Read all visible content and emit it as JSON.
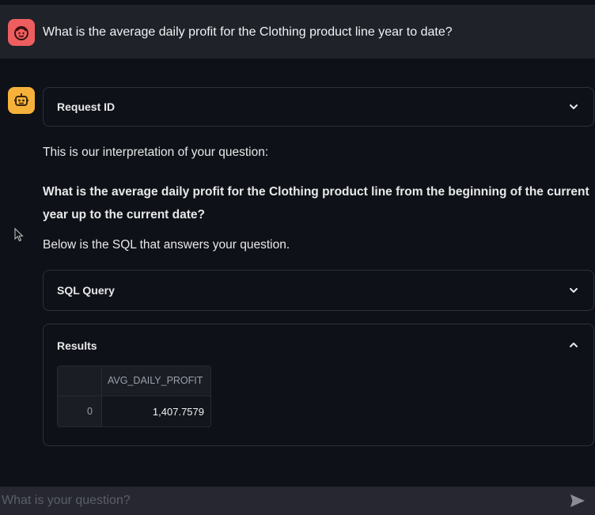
{
  "user_message": {
    "text": "What is the average daily profit for the Clothing product line year to date?",
    "avatar_icon": "smiling-face-icon",
    "avatar_color": "#ee5e5e"
  },
  "assistant": {
    "avatar_icon": "robot-icon",
    "avatar_color": "#f5b13a",
    "request_expander": {
      "label": "Request ID",
      "state": "collapsed"
    },
    "intro_text": "This is our interpretation of your question:",
    "interpretation": "What is the average daily profit for the Clothing product line from the beginning of the current year up to the current date?",
    "sql_intro": "Below is the SQL that answers your question.",
    "sql_expander": {
      "label": "SQL Query",
      "state": "collapsed"
    },
    "results_expander": {
      "label": "Results",
      "state": "expanded",
      "table": {
        "columns": [
          "",
          "AVG_DAILY_PROFIT"
        ],
        "rows": [
          {
            "index": "0",
            "avg_daily_profit": "1,407.7579"
          }
        ]
      }
    }
  },
  "chat_input": {
    "placeholder": "What is your question?",
    "value": "",
    "send_icon": "send-arrow-icon"
  }
}
